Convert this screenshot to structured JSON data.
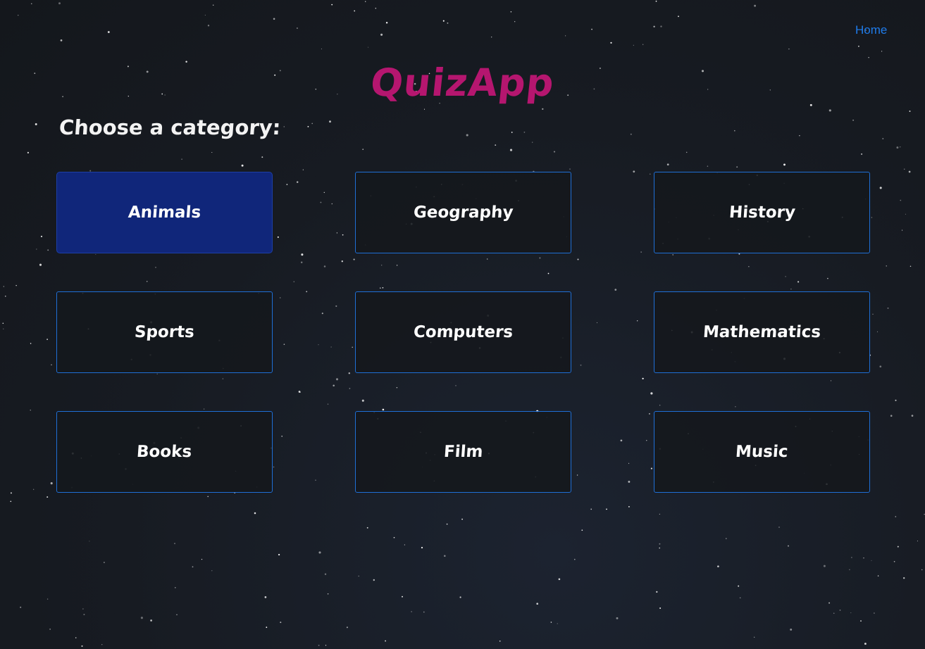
{
  "nav": {
    "home_label": "Home"
  },
  "header": {
    "title": "QuizApp"
  },
  "main": {
    "subtitle": "Choose a category:",
    "categories": [
      {
        "label": "Animals",
        "active": true
      },
      {
        "label": "Geography",
        "active": false
      },
      {
        "label": "History",
        "active": false
      },
      {
        "label": "Sports",
        "active": false
      },
      {
        "label": "Computers",
        "active": false
      },
      {
        "label": "Mathematics",
        "active": false
      },
      {
        "label": "Books",
        "active": false
      },
      {
        "label": "Film",
        "active": false
      },
      {
        "label": "Music",
        "active": false
      }
    ]
  },
  "colors": {
    "title": "#b5166f",
    "accent": "#1f7bea",
    "active_button": "#10267a",
    "button_border": "#1f6fd6"
  }
}
